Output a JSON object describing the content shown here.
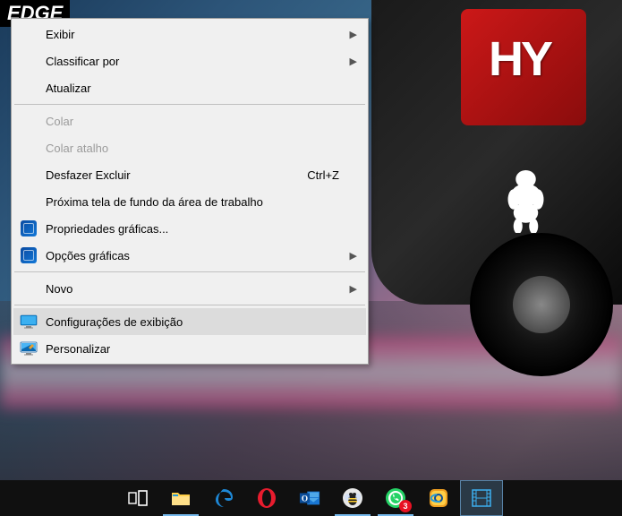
{
  "wallpaper": {
    "car_logo": "HY",
    "top_left_badge": "EDGE"
  },
  "context_menu": {
    "groups": [
      [
        {
          "label": "Exibir",
          "submenu": true
        },
        {
          "label": "Classificar por",
          "submenu": true
        },
        {
          "label": "Atualizar"
        }
      ],
      [
        {
          "label": "Colar",
          "disabled": true
        },
        {
          "label": "Colar atalho",
          "disabled": true
        },
        {
          "label": "Desfazer Excluir",
          "shortcut": "Ctrl+Z"
        },
        {
          "label": "Próxima tela de fundo da área de trabalho"
        },
        {
          "label": "Propriedades gráficas...",
          "icon": "intel"
        },
        {
          "label": "Opções gráficas",
          "icon": "intel",
          "submenu": true
        }
      ],
      [
        {
          "label": "Novo",
          "submenu": true
        }
      ],
      [
        {
          "label": "Configurações de exibição",
          "icon": "monitor",
          "highlighted": true
        },
        {
          "label": "Personalizar",
          "icon": "personalize"
        }
      ]
    ]
  },
  "taskbar": {
    "items": [
      {
        "name": "task-view",
        "icon": "taskview"
      },
      {
        "name": "file-explorer",
        "icon": "explorer",
        "active": true
      },
      {
        "name": "edge",
        "icon": "edge"
      },
      {
        "name": "opera",
        "icon": "opera"
      },
      {
        "name": "outlook",
        "icon": "outlook"
      },
      {
        "name": "app-bee",
        "icon": "bee",
        "active": true
      },
      {
        "name": "whatsapp",
        "icon": "whatsapp",
        "active": true,
        "badge": "3"
      },
      {
        "name": "bluestacks",
        "icon": "bluestacks"
      },
      {
        "name": "video-app",
        "icon": "film",
        "selected": true
      }
    ]
  }
}
